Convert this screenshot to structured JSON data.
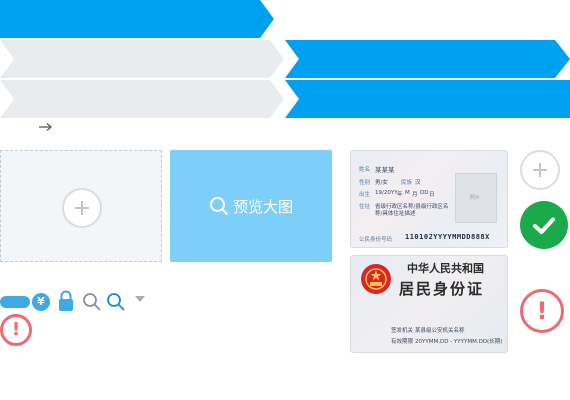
{
  "steps": {
    "row1": [
      {
        "state": "active"
      }
    ],
    "row2": [
      {
        "state": "inactive"
      },
      {
        "state": "active"
      }
    ],
    "row3": [
      {
        "state": "inactive"
      },
      {
        "state": "active"
      }
    ]
  },
  "upload": {
    "preview_label": "预览大图"
  },
  "id_front": {
    "name_label": "姓名",
    "name_value": "某某某",
    "sex_label": "性别",
    "sex_value": "男/女",
    "ethnic_label": "民族",
    "ethnic_value": "汉",
    "birth_label": "出生",
    "birth_value": "19/20YY",
    "birth_month_label": "年",
    "birth_month_value": "M",
    "birth_day_label": "月",
    "birth_day_value": "DD",
    "birth_day_suffix": "日",
    "addr_label": "住址",
    "addr_value_1": "省级行政区名称/县级行政区名",
    "addr_value_2": "称/具体住址描述",
    "photo_label": "照片",
    "id_label": "公民身份号码",
    "id_value": "110102YYYYMMDD888X"
  },
  "id_back": {
    "country": "中华人民共和国",
    "doc_title": "居民身份证",
    "authority_label": "签发机关",
    "authority_value": "某县级公安机关名称",
    "validity_label": "有效期限",
    "validity_value": "20YYMM.DD - YYYYMM.DD(长期)"
  },
  "icons": {
    "currency_symbol": "¥",
    "warn_symbol": "!"
  },
  "colors": {
    "primary": "#00a0f0",
    "inactive": "#e9ecee",
    "preview": "#7dcffa",
    "success": "#1aaa4a",
    "danger": "#ef6a6f"
  }
}
